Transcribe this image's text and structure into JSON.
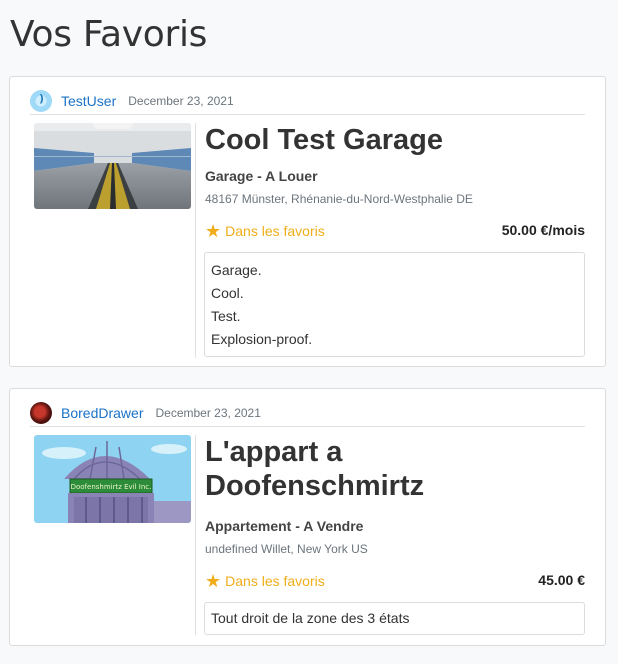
{
  "page": {
    "title": "Vos Favoris"
  },
  "favorites": [
    {
      "user": "TestUser",
      "date": "December 23, 2021",
      "avatar": "user-avatar-light-blue",
      "title": "Cool Test Garage",
      "type": "Garage - A Louer",
      "address": "48167 Münster, Rhénanie-du-Nord-Westphalie DE",
      "favorite_label": "Dans les favoris",
      "favorite_icon": "star-icon",
      "price": "50.00 €/mois",
      "description": [
        "Garage.",
        "Cool.",
        "Test.",
        "Explosion-proof."
      ]
    },
    {
      "user": "BoredDrawer",
      "date": "December 23, 2021",
      "avatar": "user-avatar-red",
      "title_lines": [
        "L'appart a",
        "Doofenschmirtz"
      ],
      "type": "Appartement - A Vendre",
      "address": "undefined Willet, New York US",
      "favorite_label": "Dans les favoris",
      "favorite_icon": "star-icon",
      "price": "45.00 €",
      "description": [
        "Tout droit de la zone des 3 états"
      ],
      "building_sign": "Doofenshmirtz Evil Inc."
    }
  ],
  "colors": {
    "link": "#1a73c8",
    "favorite": "#f0ad1a"
  }
}
